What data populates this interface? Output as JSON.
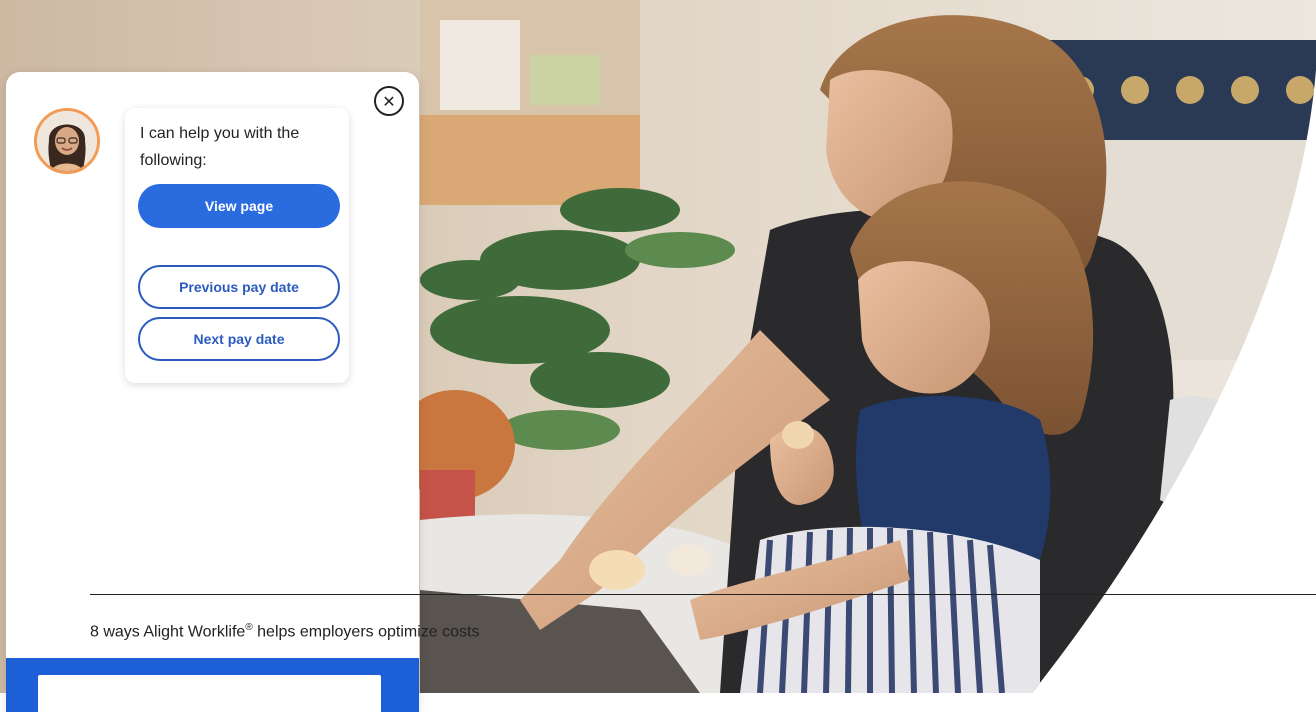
{
  "chat": {
    "intro_text": "I can help you with the following:",
    "buttons": {
      "view_page": "View page",
      "previous_pay_date": "Previous pay date",
      "next_pay_date": "Next pay date"
    },
    "close_icon": "close-circle-icon",
    "avatar": "assistant-avatar"
  },
  "caption": {
    "text_before": "8 ways Alight Worklife",
    "registered_mark": "®",
    "text_after": " helps employers optimize costs"
  },
  "colors": {
    "primary_blue": "#2b6be0",
    "outline_blue": "#2b5bbf",
    "composer_blue": "#1d5fd6",
    "avatar_ring": "#f29b55"
  }
}
